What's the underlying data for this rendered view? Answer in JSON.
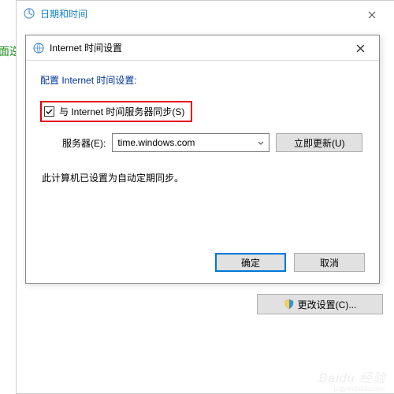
{
  "page_text": "面逆",
  "parent": {
    "title": "日期和时间",
    "change_settings_label": "更改设置(C)..."
  },
  "child": {
    "title": "Internet 时间设置",
    "config_label": "配置 Internet 时间设置:",
    "checkbox_label": "与 Internet 时间服务器同步(S)",
    "server_label": "服务器(E):",
    "server_value": "time.windows.com",
    "update_now_label": "立即更新(U)",
    "status_text": "此计算机已设置为自动定期同步。",
    "ok_label": "确定",
    "cancel_label": "取消"
  },
  "watermark": {
    "main": "Baidu 经验",
    "sub": "jingyan.baidu.com"
  }
}
